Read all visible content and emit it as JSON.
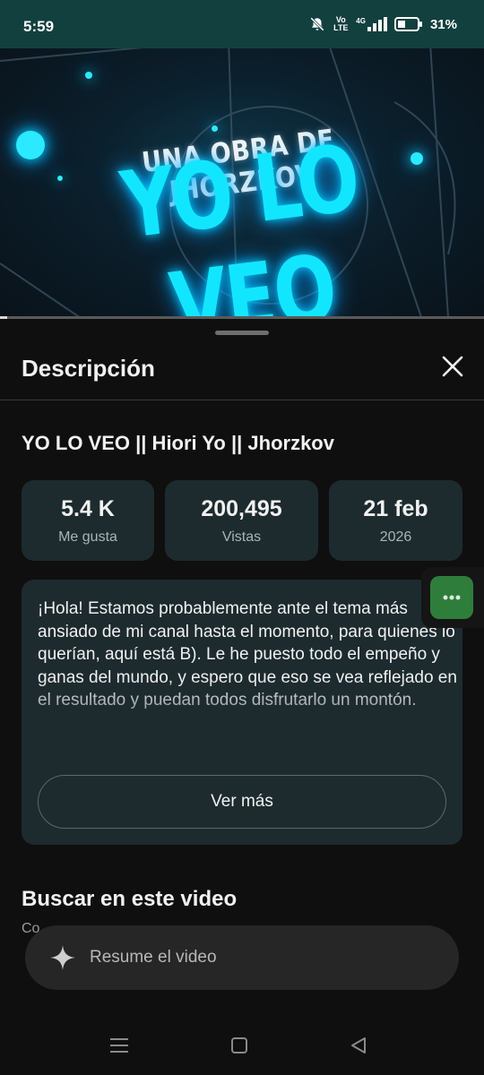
{
  "status_bar": {
    "time": "5:59",
    "network_label": "Vo LTE",
    "signal_label": "4G",
    "battery_percent": "31%"
  },
  "thumbnail": {
    "subtitle": "UNA OBRA DE JHORZKOV",
    "title": "YO LO VEO",
    "accent_color": "#12e6ff",
    "progress_fraction": 0.015
  },
  "sheet": {
    "title": "Descripción"
  },
  "video": {
    "title": "YO LO VEO || Hiori Yo || Jhorzkov"
  },
  "stats": [
    {
      "value": "5.4 K",
      "label": "Me gusta"
    },
    {
      "value": "200,495",
      "label": "Vistas"
    },
    {
      "value": "21 feb",
      "label": "2026"
    }
  ],
  "description": {
    "text": "¡Hola! Estamos probablemente ante el tema más ansiado de mi canal hasta el momento, para quienes lo querían, aquí está B). Le he puesto todo el empeño y ganas del mundo, y espero que eso se vea reflejado en el resultado y puedan todos disfrutarlo un montón.",
    "more_label": "Ver más"
  },
  "search_section": {
    "heading": "Buscar en este video",
    "subtext": "Co"
  },
  "ask_bar": {
    "placeholder": "Resume el video",
    "icon": "sparkle-icon"
  },
  "colors": {
    "card_bg": "#1d2b2f",
    "status_bar_bg": "#12403f",
    "bubble_bg": "#2f7d3a"
  }
}
